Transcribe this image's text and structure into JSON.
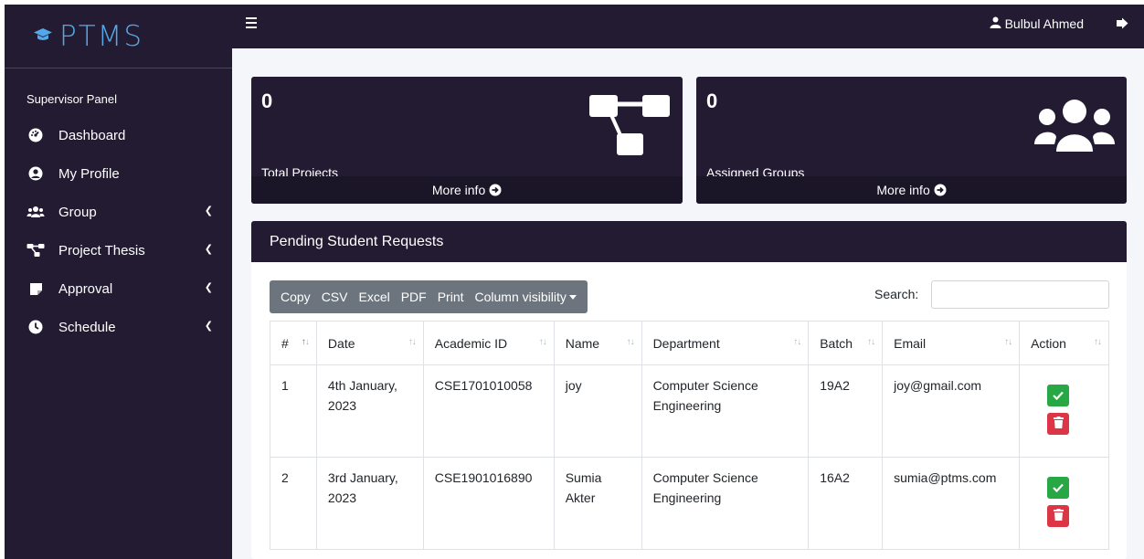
{
  "brand": {
    "name": "PTMS",
    "accent": "#54a7e8"
  },
  "sidebar": {
    "panel_label": "Supervisor Panel",
    "items": [
      {
        "label": "Dashboard",
        "icon": "tachometer-icon",
        "has_submenu": false
      },
      {
        "label": "My Profile",
        "icon": "user-circle-icon",
        "has_submenu": false
      },
      {
        "label": "Group",
        "icon": "users-icon",
        "has_submenu": true
      },
      {
        "label": "Project Thesis",
        "icon": "project-diagram-icon",
        "has_submenu": true
      },
      {
        "label": "Approval",
        "icon": "sticky-note-icon",
        "has_submenu": true
      },
      {
        "label": "Schedule",
        "icon": "clock-icon",
        "has_submenu": true
      }
    ]
  },
  "topbar": {
    "user_name": "Bulbul Ahmed"
  },
  "stats": [
    {
      "value": "0",
      "label": "Total Projects",
      "more": "More info",
      "icon": "project-diagram-icon"
    },
    {
      "value": "0",
      "label": "Assigned Groups",
      "more": "More info",
      "icon": "users-icon"
    }
  ],
  "requests": {
    "title": "Pending Student Requests",
    "buttons": [
      "Copy",
      "CSV",
      "Excel",
      "PDF",
      "Print",
      "Column visibility"
    ],
    "search_label": "Search:",
    "search_value": "",
    "columns": [
      "#",
      "Date",
      "Academic ID",
      "Name",
      "Department",
      "Batch",
      "Email",
      "Action"
    ],
    "rows": [
      {
        "num": "1",
        "date": "4th January, 2023",
        "academic_id": "CSE1701010058",
        "name": "joy",
        "department": "Computer Science Engineering",
        "batch": "19A2",
        "email": "joy@gmail.com"
      },
      {
        "num": "2",
        "date": "3rd January, 2023",
        "academic_id": "CSE1901016890",
        "name": "Sumia Akter",
        "department": "Computer Science Engineering",
        "batch": "16A2",
        "email": "sumia@ptms.com"
      }
    ]
  },
  "colors": {
    "dark": "#221b32",
    "approve": "#28a745",
    "delete": "#dc3545",
    "toolbar": "#6c757d"
  }
}
